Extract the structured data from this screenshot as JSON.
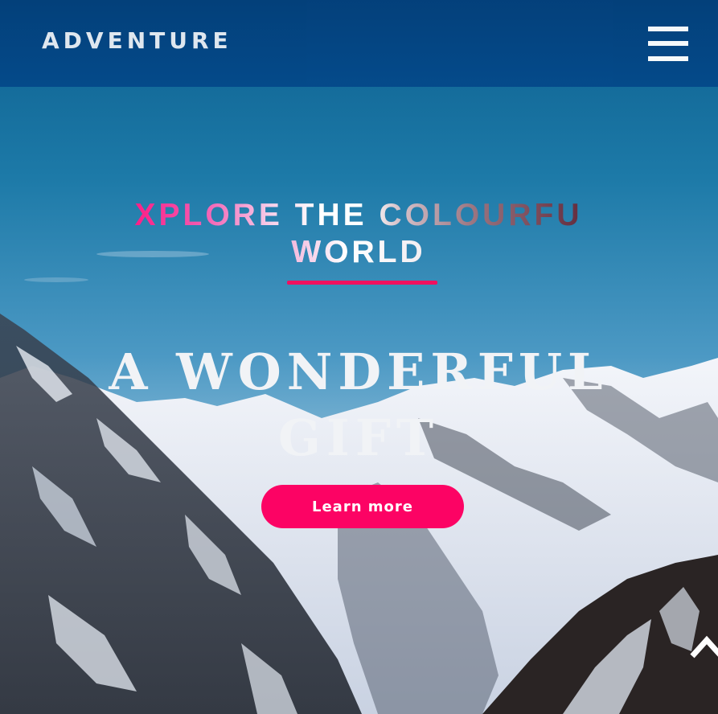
{
  "header": {
    "logo_text": "ADVENTURE",
    "menu_icon": "hamburger-menu-icon"
  },
  "hero": {
    "tagline_line1": "XPLORE THE COLOURFU",
    "tagline_line2": "WORLD",
    "headline": "A WONDERFUL GIFT",
    "cta_label": "Learn more"
  },
  "scroll_top_icon": "chevron-up-icon",
  "colors": {
    "header_bg": "#04468a",
    "accent": "#fc0364",
    "underline": "#f0105f",
    "text": "#f1f3f6"
  }
}
